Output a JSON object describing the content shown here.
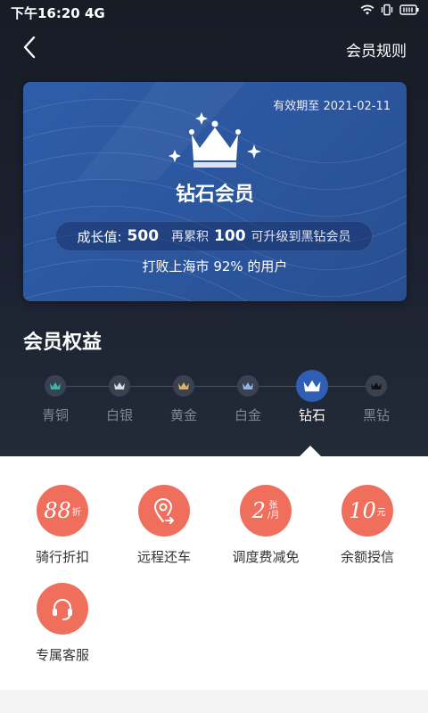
{
  "status": {
    "time": "下午16:20",
    "network": "4G"
  },
  "nav": {
    "rules": "会员规则"
  },
  "card": {
    "expiry_prefix": "有效期至",
    "expiry_date": "2021-02-11",
    "level_name": "钻石会员",
    "growth_label": "成长值:",
    "growth_value": "500",
    "accumulate_label": "再累积",
    "accumulate_value": "100",
    "upgrade_text": "可升级到黑钻会员",
    "beat_text": "打败上海市 92% 的用户"
  },
  "benefits_title": "会员权益",
  "levels": [
    {
      "label": "青铜",
      "color": "#3fb3a8"
    },
    {
      "label": "白银",
      "color": "#d9dde3"
    },
    {
      "label": "黄金",
      "color": "#d6b26b"
    },
    {
      "label": "白金",
      "color": "#8fb4e0"
    },
    {
      "label": "钻石",
      "color": "#ffffff",
      "active": true
    },
    {
      "label": "黑钻",
      "color": "#111111"
    }
  ],
  "benefits": [
    {
      "icon": "discount-badge",
      "label": "骑行折扣",
      "num": "88",
      "unit": "折"
    },
    {
      "icon": "location-return-icon",
      "label": "远程还车"
    },
    {
      "icon": "ticket-badge",
      "label": "调度费减免",
      "num": "2",
      "unit_top": "张",
      "unit_bottom": "/月"
    },
    {
      "icon": "credit-badge",
      "label": "余额授信",
      "num": "10",
      "unit": "元"
    },
    {
      "icon": "headset-icon",
      "label": "专属客服"
    }
  ],
  "accent": "#ef6f5c"
}
